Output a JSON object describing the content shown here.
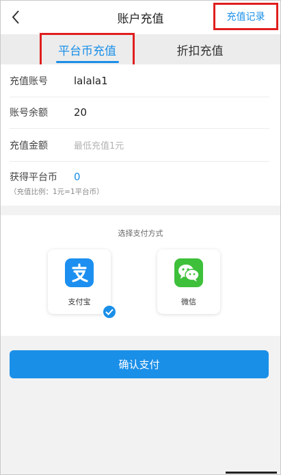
{
  "header": {
    "title": "账户充值",
    "history_label": "充值记录"
  },
  "tabs": [
    {
      "label": "平台币充值",
      "active": true
    },
    {
      "label": "折扣充值",
      "active": false
    }
  ],
  "form": {
    "account": {
      "label": "充值账号",
      "value": "lalala1"
    },
    "balance": {
      "label": "账号余额",
      "value": "20"
    },
    "amount": {
      "label": "充值金额",
      "placeholder": "最低充值1元"
    },
    "coins": {
      "label": "获得平台币",
      "value": "0"
    },
    "ratio_note": "（充值比例：1元=1平台币）"
  },
  "payment": {
    "title": "选择支付方式",
    "methods": [
      {
        "name": "支付宝",
        "icon": "alipay-icon",
        "selected": true
      },
      {
        "name": "微信",
        "icon": "wechat-icon",
        "selected": false
      }
    ]
  },
  "confirm_label": "确认支付",
  "colors": {
    "accent": "#1a8fe8",
    "highlight": "#e01e1e",
    "alipay": "#1c8ff0",
    "wechat": "#3ec03b"
  }
}
